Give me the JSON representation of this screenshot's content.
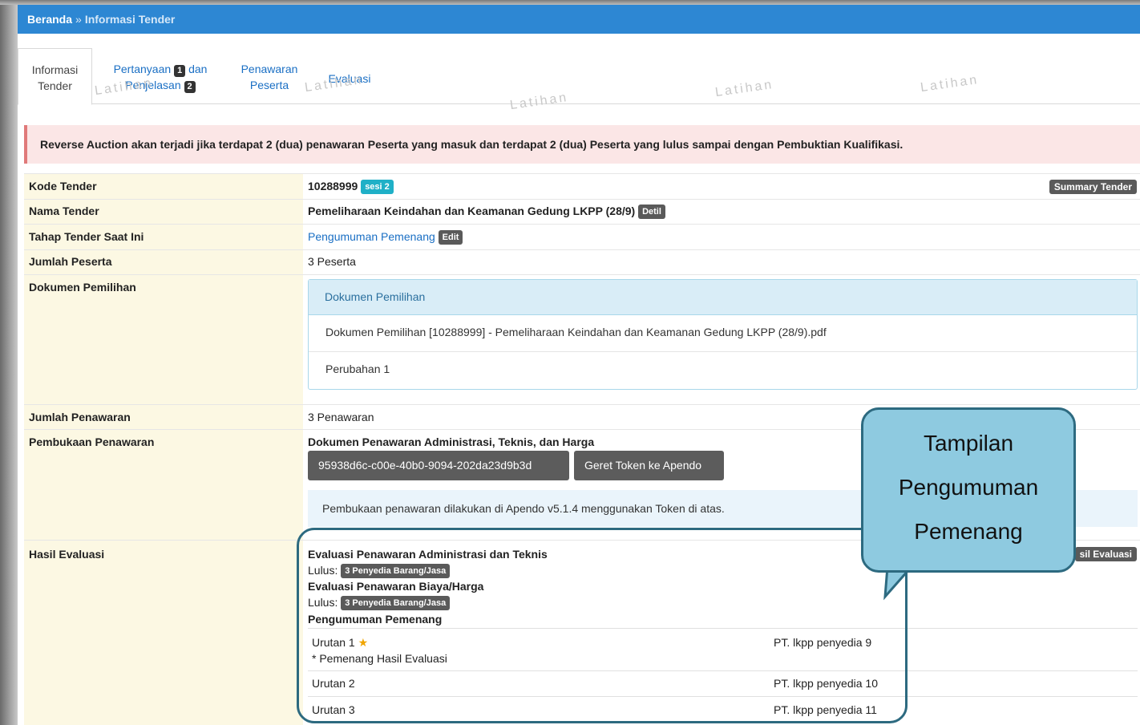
{
  "breadcrumb": {
    "home": "Beranda",
    "separator": "»",
    "current": "Informasi Tender"
  },
  "tabs": {
    "info_line1": "Informasi",
    "info_line2": "Tender",
    "tanya_line1a": "Pertanyaan",
    "tanya_badge1": "1",
    "tanya_line1b": "dan",
    "tanya_line2a": "Penjelasan",
    "tanya_badge2": "2",
    "penawaran_line1": "Penawaran",
    "penawaran_line2": "Peserta",
    "evaluasi": "Evaluasi"
  },
  "watermark": "Latihan",
  "alert": "Reverse Auction akan terjadi jika terdapat 2 (dua) penawaran Peserta yang masuk dan terdapat 2 (dua) Peserta yang lulus sampai dengan Pembuktian Kualifikasi.",
  "rows": {
    "kode": {
      "label": "Kode Tender",
      "value": "10288999",
      "badge": "sesi 2",
      "button": "Summary Tender"
    },
    "nama": {
      "label": "Nama Tender",
      "value": "Pemeliharaan Keindahan dan Keamanan Gedung LKPP (28/9)",
      "badge": "Detil"
    },
    "tahap": {
      "label": "Tahap Tender Saat Ini",
      "value": "Pengumuman Pemenang",
      "badge": "Edit"
    },
    "jumlah_peserta": {
      "label": "Jumlah Peserta",
      "value": "3 Peserta"
    },
    "dokumen": {
      "label": "Dokumen Pemilihan",
      "panel_title": "Dokumen Pemilihan",
      "file": "Dokumen Pemilihan [10288999] - Pemeliharaan Keindahan dan Keamanan Gedung LKPP (28/9).pdf",
      "perubahan": "Perubahan 1"
    },
    "jumlah_penawaran": {
      "label": "Jumlah Penawaran",
      "value": "3 Penawaran"
    },
    "pembukaan": {
      "label": "Pembukaan Penawaran",
      "title": "Dokumen Penawaran Administrasi, Teknis, dan Harga",
      "token": "95938d6c-c00e-40b0-9094-202da23d9b3d",
      "geret": "Geret Token ke Apendo",
      "info": "Pembukaan penawaran dilakukan di Apendo v5.1.4 menggunakan Token di atas."
    },
    "hasil": {
      "label": "Hasil Evaluasi",
      "button": "sil Evaluasi",
      "admin_title": "Evaluasi Penawaran Administrasi dan Teknis",
      "lulus_label": "Lulus:",
      "admin_badge": "3 Penyedia Barang/Jasa",
      "biaya_title": "Evaluasi Penawaran Biaya/Harga",
      "biaya_badge": "3 Penyedia Barang/Jasa",
      "pemenang_title": "Pengumuman Pemenang",
      "winners": [
        {
          "rank": "Urutan 1",
          "note": "* Pemenang Hasil Evaluasi",
          "name": "PT. lkpp penyedia 9"
        },
        {
          "rank": "Urutan 2",
          "name": "PT. lkpp penyedia 10"
        },
        {
          "rank": "Urutan 3",
          "name": "PT. lkpp penyedia 11"
        }
      ]
    }
  },
  "callout": {
    "line1": "Tampilan",
    "line2": "Pengumuman",
    "line3": "Pemenang"
  },
  "colors": {
    "header": "#2d87d3",
    "label_bg": "#fcf8e3",
    "callout_bg": "#8ecae0",
    "callout_border": "#2d6a80",
    "star": "#f0a500"
  }
}
